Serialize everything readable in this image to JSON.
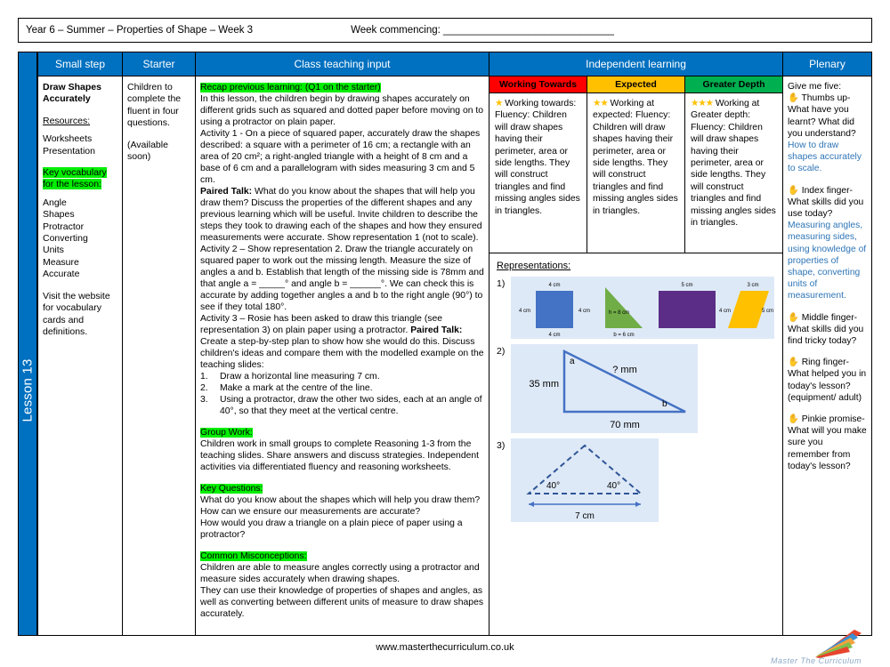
{
  "header": {
    "title": "Year 6 – Summer – Properties of Shape – Week 3",
    "week_commencing": "Week commencing: ______________________________"
  },
  "lesson_tab": {
    "label": "Lesson 13"
  },
  "columns": {
    "small_step": "Small step",
    "starter": "Starter",
    "class_teaching_input": "Class teaching input",
    "independent_learning": "Independent learning",
    "plenary": "Plenary"
  },
  "small_step": {
    "title": "Draw Shapes Accurately",
    "resources_heading": "Resources:",
    "resources": [
      "Worksheets",
      "Presentation"
    ],
    "vocab_heading": "Key vocabulary for the lesson:",
    "vocab": [
      "Angle",
      "Shapes",
      "Protractor",
      "Converting",
      "Units",
      "Measure",
      "Accurate"
    ],
    "footnote": "Visit the website for vocabulary cards and definitions."
  },
  "starter": {
    "line1": "Children to complete the fluent in four questions.",
    "line2": "(Available soon)"
  },
  "teaching": {
    "recap_heading": "Recap previous learning: (Q1 on the starter)",
    "recap_body": "In this lesson, the children begin by drawing shapes accurately on different grids such as squared and dotted paper before moving on to using a protractor on plain paper.",
    "activity1": "Activity 1 - On a piece of squared paper, accurately draw the shapes described: a square with a perimeter of 16 cm; a rectangle with an area of 20 cm²; a right-angled triangle with a height of 8 cm and a base of 6 cm and a parallelogram with sides measuring 3 cm and 5 cm.",
    "paired_talk_1_label": "Paired Talk:",
    "paired_talk_1": "What do you know about the shapes that will help you draw them? Discuss the properties of the different shapes and any previous learning which will be useful. Invite children to describe the steps they took to drawing each of the shapes and how they ensured measurements were accurate. Show representation 1 (not to scale).",
    "activity2": "Activity 2 – Show representation 2. Draw the triangle accurately on squared paper to work out the missing length. Measure the size of angles a and b. Establish that length of the missing side is 78mm and that angle a = _____° and angle b = ______°. We can check this is accurate by adding together angles a and b to the right angle (90°) to see if they total 180°.",
    "activity3_pre": "Activity 3 – Rosie has been asked to draw this triangle (see representation 3) on plain paper using a protractor.",
    "paired_talk_2_label": "Paired Talk:",
    "activity3_post": "Create a step-by-step plan to show how she would do this. Discuss children's ideas and compare them with the modelled example on the teaching slides:",
    "steps": [
      {
        "num": "1.",
        "text": "Draw a horizontal line measuring 7 cm."
      },
      {
        "num": "2.",
        "text": "Make a mark at the centre of the line."
      },
      {
        "num": "3.",
        "text": "Using a protractor, draw the other two sides, each at an angle of 40°, so that they meet at the vertical centre."
      }
    ],
    "group_work_heading": "Group Work:",
    "group_work_body": "Children work in small groups to complete Reasoning 1-3 from the teaching slides. Share answers and discuss strategies. Independent activities via differentiated fluency and reasoning worksheets.",
    "key_questions_heading": "Key Questions:",
    "key_questions": [
      "What do you know about the shapes which will help you draw them?",
      "How can we ensure our measurements are accurate?",
      "How would you draw a triangle on a plain piece of paper using a protractor?"
    ],
    "misconceptions_heading": "Common Misconceptions:",
    "misconceptions": [
      "Children are able to measure angles correctly using a protractor and measure sides accurately when drawing shapes.",
      "They can use their knowledge of properties of shapes and angles, as well as converting between different units of measure to draw shapes accurately."
    ]
  },
  "independent": {
    "bands": [
      {
        "label": "Working Towards",
        "color": "#FF0000"
      },
      {
        "label": "Expected",
        "color": "#FFC000"
      },
      {
        "label": "Greater Depth",
        "color": "#00B050"
      }
    ],
    "cells": [
      {
        "stars": "★",
        "lead": "Working towards:",
        "body": "Fluency: Children will draw shapes having their perimeter, area or side lengths. They will construct triangles and find missing angles sides in triangles."
      },
      {
        "stars": "★★",
        "lead": "Working at expected:",
        "body": "Fluency: Children will draw shapes having their perimeter, area or side lengths. They will construct triangles and find missing angles sides in triangles."
      },
      {
        "stars": "★★★",
        "lead": "Working at Greater depth:",
        "body": "Fluency: Children will draw shapes having their perimeter, area or side lengths. They will construct triangles and find missing angles sides in triangles."
      }
    ],
    "representations_heading": "Representations:",
    "rep1": {
      "num": "1)",
      "square": {
        "top": "4 cm",
        "left": "4 cm",
        "right": "4 cm",
        "bottom": "4 cm",
        "color": "#4472C4"
      },
      "triangle": {
        "height": "h = 8 cm",
        "base": "b = 6 cm",
        "color": "#70AD47"
      },
      "rectangle": {
        "top": "5 cm",
        "right": "4 cm",
        "color": "#5B2D86"
      },
      "parallelogram": {
        "top": "3 cm",
        "right": "5 cm",
        "color": "#FFC000"
      }
    },
    "rep2": {
      "num": "2)",
      "angle_a": "a",
      "angle_b": "b",
      "hypotenuse": "? mm",
      "height": "35 mm",
      "base": "70 mm",
      "color": "#4472C4"
    },
    "rep3": {
      "num": "3)",
      "left_angle": "40°",
      "right_angle": "40°",
      "base": "7 cm",
      "color": "#2F5597"
    }
  },
  "plenary": {
    "intro": "Give me five:",
    "items": [
      {
        "hand": "✋",
        "q": "Thumbs up- What have you learnt? What did you understand?",
        "a": "How to draw shapes accurately to scale."
      },
      {
        "hand": "✋",
        "q": "Index finger- What skills did you use today?",
        "a": "Measuring angles, measuring sides, using knowledge of properties of shape, converting units of measurement."
      },
      {
        "hand": "✋",
        "q": "Middle finger- What skills did you find tricky today?",
        "a": ""
      },
      {
        "hand": "✋",
        "q": "Ring finger- What helped you in today's lesson? (equipment/ adult)",
        "a": ""
      },
      {
        "hand": "✋",
        "q": "Pinkie promise- What will you make sure you remember from today's lesson?",
        "a": ""
      }
    ]
  },
  "footer": {
    "url": "www.masterthecurriculum.co.uk",
    "logo_text": "Master The Curriculum"
  }
}
